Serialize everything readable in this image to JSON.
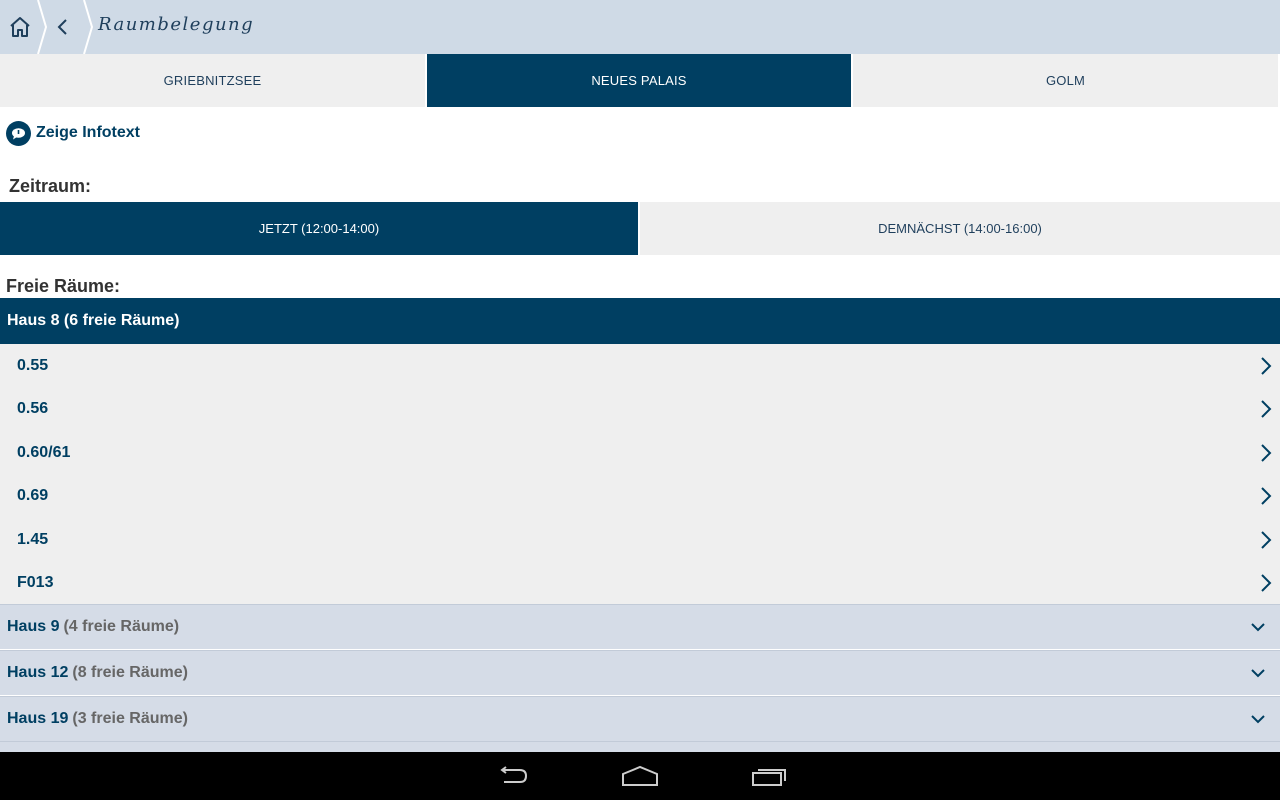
{
  "header": {
    "title": "Raumbelegung",
    "home_icon": "home-icon",
    "back_icon": "back-chevron-icon"
  },
  "campus_tabs": [
    {
      "label": "GRIEBNITZSEE",
      "active": false
    },
    {
      "label": "NEUES PALAIS",
      "active": true
    },
    {
      "label": "GOLM",
      "active": false
    }
  ],
  "info": {
    "label": "Zeige Infotext",
    "icon": "speech-bubble-info-icon"
  },
  "time_section": {
    "label": "Zeitraum:",
    "tabs": [
      {
        "label": "JETZT (12:00-14:00)",
        "active": true
      },
      {
        "label": "DEMNÄCHST (14:00-16:00)",
        "active": false
      }
    ]
  },
  "free_rooms": {
    "label": "Freie Räume:",
    "expanded_group": {
      "title": "Haus 8 (6 freie Räume)",
      "rooms": [
        "0.55",
        "0.56",
        "0.60/61",
        "0.69",
        "1.45",
        "F013"
      ]
    },
    "collapsed_groups": [
      {
        "name": "Haus 9",
        "count": "(4 freie Räume)"
      },
      {
        "name": "Haus 12",
        "count": "(8 freie Räume)"
      },
      {
        "name": "Haus 19",
        "count": "(3 freie Räume)"
      }
    ]
  },
  "colors": {
    "primary": "#003f62",
    "header_bg": "#cfdae6",
    "list_bg": "#efefef",
    "group_bg": "#d5dce7"
  },
  "navbar": {
    "back_icon": "android-back-icon",
    "home_icon": "android-home-icon",
    "recents_icon": "android-recents-icon"
  }
}
